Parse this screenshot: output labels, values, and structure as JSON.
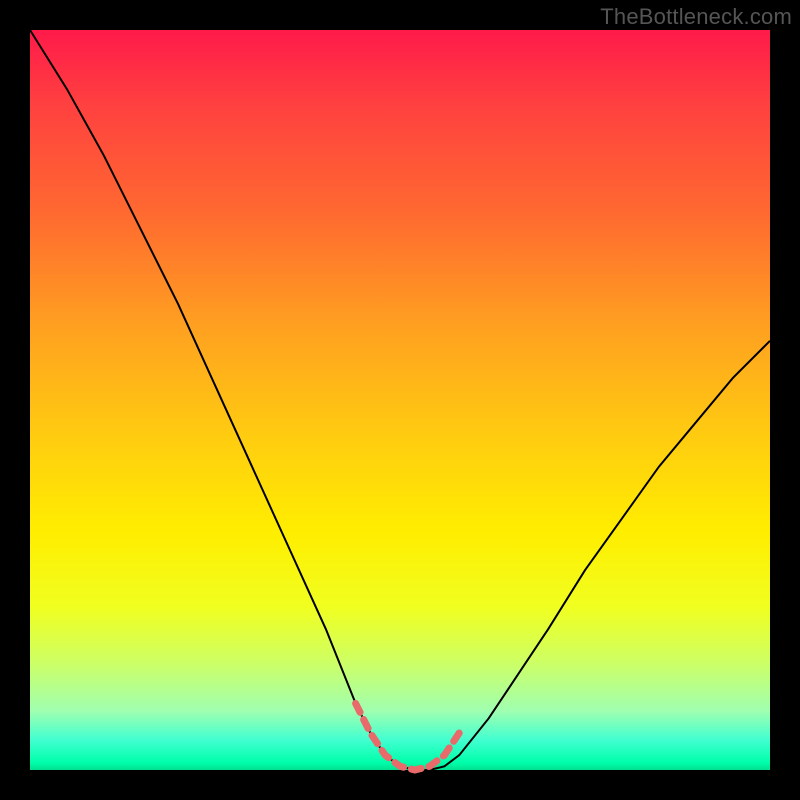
{
  "watermark": "TheBottleneck.com",
  "colors": {
    "gradient_top": "#ff1a4a",
    "gradient_bottom": "#00e090",
    "curve": "#000000",
    "highlight": "#e86a6a",
    "frame": "#000000"
  },
  "chart_data": {
    "type": "line",
    "title": "",
    "xlabel": "",
    "ylabel": "",
    "xlim": [
      0,
      100
    ],
    "ylim": [
      0,
      100
    ],
    "axes_visible": false,
    "grid": false,
    "series": [
      {
        "name": "bottleneck-curve",
        "x": [
          0,
          5,
          10,
          15,
          20,
          25,
          30,
          35,
          40,
          44,
          46,
          48,
          50,
          52,
          54,
          56,
          58,
          62,
          66,
          70,
          75,
          80,
          85,
          90,
          95,
          100
        ],
        "y": [
          100,
          92,
          83,
          73,
          63,
          52,
          41,
          30,
          19,
          9,
          5,
          2,
          0.5,
          0,
          0,
          0.5,
          2,
          7,
          13,
          19,
          27,
          34,
          41,
          47,
          53,
          58
        ]
      }
    ],
    "highlight": {
      "name": "optimal-range",
      "style": "dashed",
      "x": [
        44,
        46,
        48,
        50,
        52,
        54,
        56,
        58
      ],
      "y": [
        9,
        5,
        2,
        0.5,
        0,
        0.5,
        2,
        5
      ]
    },
    "background_gradient": {
      "direction": "vertical",
      "stops": [
        {
          "pos": 0.0,
          "color": "#ff1a4a"
        },
        {
          "pos": 0.25,
          "color": "#ff6a30"
        },
        {
          "pos": 0.55,
          "color": "#ffcc10"
        },
        {
          "pos": 0.78,
          "color": "#f0ff20"
        },
        {
          "pos": 0.92,
          "color": "#a0ffb0"
        },
        {
          "pos": 1.0,
          "color": "#00e090"
        }
      ]
    }
  }
}
